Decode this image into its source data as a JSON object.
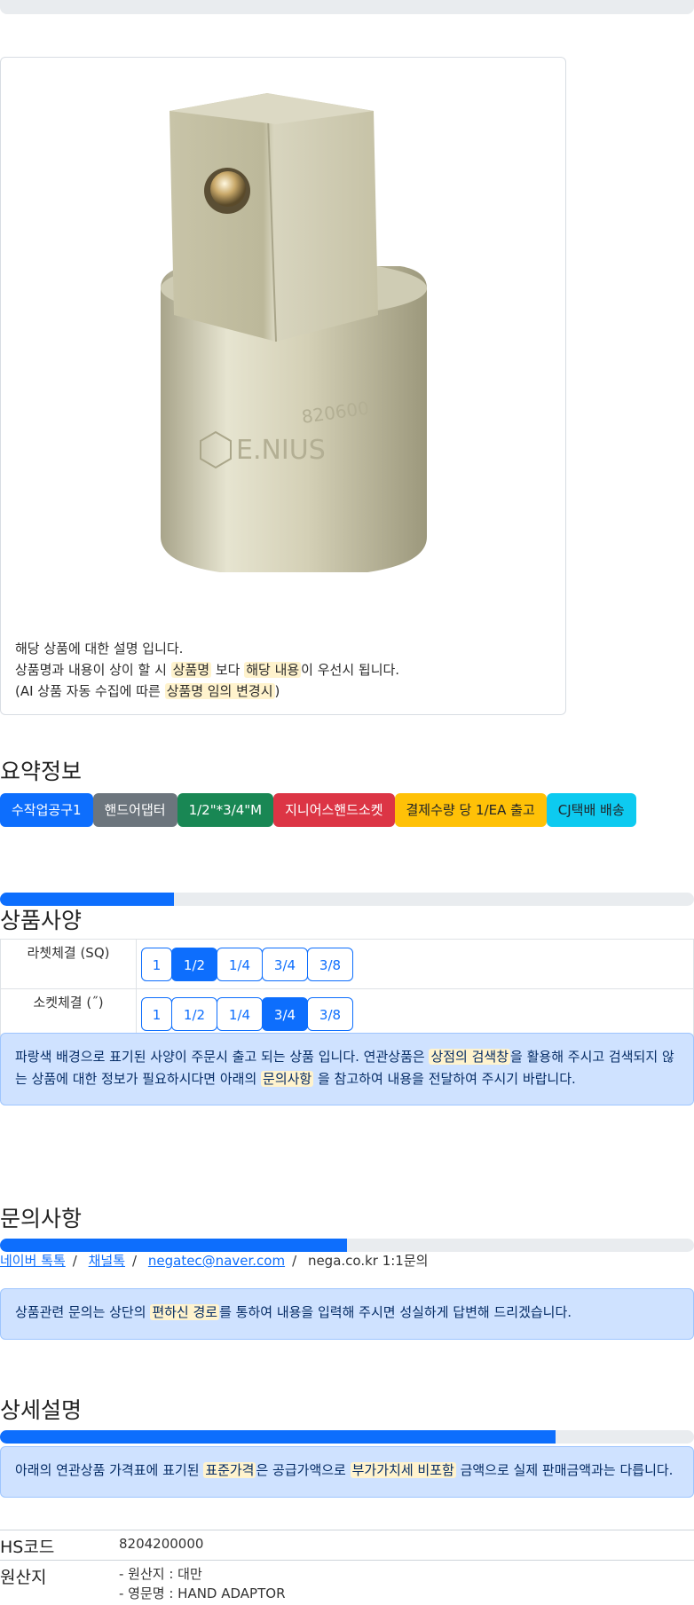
{
  "description": {
    "line1": "해당 상품에 대한 설명 입니다.",
    "line2_a": "상품명과 내용이 상이 할 시 ",
    "line2_hl1": "상품명",
    "line2_b": " 보다 ",
    "line2_hl2": "해당 내용",
    "line2_c": "이 우선시 됩니다.",
    "line3_a": "(AI 상품 자동 수집에 따른 ",
    "line3_hl": "상품명 임의 변경시",
    "line3_b": ")",
    "image_text": "E.NIUS"
  },
  "summary": {
    "title": "요약정보",
    "badges": [
      {
        "label": "수작업공구1",
        "color": "#0d6efd"
      },
      {
        "label": "핸드어댑터",
        "color": "#6c757d"
      },
      {
        "label": "1/2\"*3/4\"M",
        "color": "#198754"
      },
      {
        "label": "지니어스핸드소켓",
        "color": "#dc3545"
      },
      {
        "label": "결제수량 당 1/EA 출고",
        "color": "#ffc107"
      },
      {
        "label": "CJ택배 배송",
        "color": "#0dcaf0"
      }
    ]
  },
  "spec": {
    "title": "상품사양",
    "progress": 0.25,
    "rows": [
      {
        "label": "라쳇체결 (SQ)",
        "options": [
          "1",
          "1/2",
          "1/4",
          "3/4",
          "3/8"
        ],
        "selected": "1/2"
      },
      {
        "label": "소켓체결 (˝)",
        "options": [
          "1",
          "1/2",
          "1/4",
          "3/4",
          "3/8"
        ],
        "selected": "3/4"
      }
    ],
    "notice_a": "파랑색 배경으로 표기된 사양이 주문시 출고 되는 상품 입니다. 연관상품은 ",
    "notice_hl1": "상점의 검색창",
    "notice_b": "을 활용해 주시고 검색되지 않는 상품에 대한 정보가 필요하시다면 아래의 ",
    "notice_hl2": "문의사항",
    "notice_c": " 을 참고하여 내용을 전달하여 주시기 바랍니다."
  },
  "inquiry": {
    "title": "문의사항",
    "progress": 0.5,
    "links": [
      "네이버 톡톡",
      "채널톡",
      "negatec@naver.com"
    ],
    "plain": "nega.co.kr 1:1문의",
    "notice_a": "상품관련 문의는 상단의 ",
    "notice_hl": "편하신 경로",
    "notice_b": "를 통하여 내용을 입력해 주시면 성실하게 답변해 드리겠습니다."
  },
  "detail": {
    "title": "상세설명",
    "progress": 0.8,
    "notice_a": "아래의 연관상품 가격표에 표기된 ",
    "notice_hl1": "표준가격",
    "notice_b": "은 공급가액으로 ",
    "notice_hl2": "부가가치세 비포함",
    "notice_c": " 금액으로 실제 판매금액과는 다릅니다."
  },
  "info": {
    "hs_label": "HS코드",
    "hs_value": "8204200000",
    "origin_label": "원산지",
    "origin_line1": "- 원산지 : 대만",
    "origin_line2": "- 영문명 : HAND ADAPTOR"
  }
}
